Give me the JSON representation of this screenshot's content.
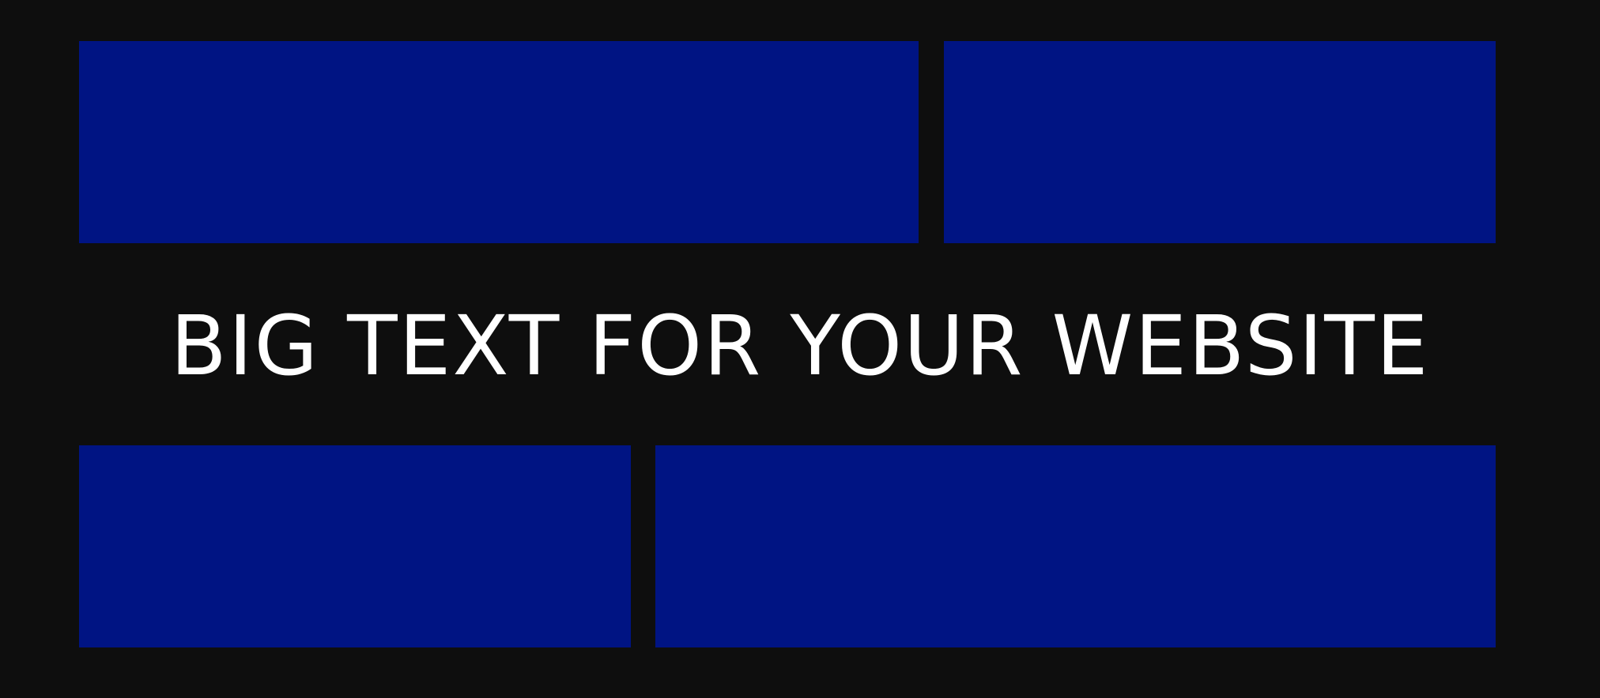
{
  "headline": {
    "text": "BIG TEXT FOR YOUR WEBSITE"
  },
  "colors": {
    "background": "#0e0e0e",
    "block": "#001483",
    "text": "#ffffff"
  }
}
